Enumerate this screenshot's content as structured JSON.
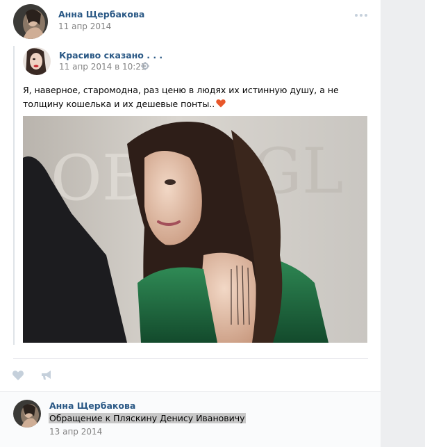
{
  "post": {
    "author_name": "Анна Щербакова",
    "date": "11 апр 2014",
    "more_icon": "three-dots-icon"
  },
  "repost": {
    "source_name": "Красиво сказано . . .",
    "date": "11 апр 2014 в 10:21",
    "text": "Я, наверное, старомодна, раз ценю в людях их истинную душу, а не толщину кошелька и их дешевые понты..",
    "emoji": "orange-heart-icon"
  },
  "actions": {
    "like_icon": "heart-icon",
    "share_icon": "megaphone-icon"
  },
  "comment": {
    "author_name": "Анна Щербакова",
    "text": "Обращение к Пляскину Денису Ивановичу",
    "date": "13 апр 2014"
  },
  "colors": {
    "link": "#2a5885",
    "meta": "#828282",
    "icon": "#c5d0db",
    "page_bg": "#edeef0"
  }
}
